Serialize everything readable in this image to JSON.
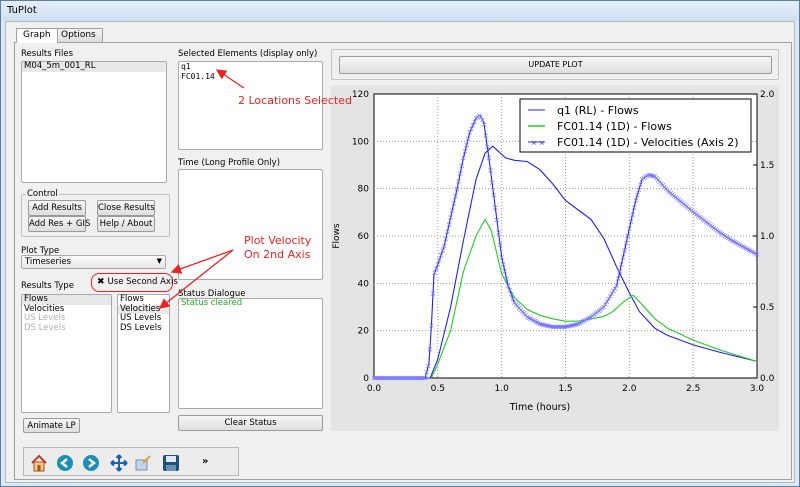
{
  "window": {
    "title": "TuPlot"
  },
  "tabs": [
    {
      "label": "Graph",
      "active": true
    },
    {
      "label": "Options",
      "active": false
    }
  ],
  "results_files": {
    "label": "Results Files",
    "items": [
      "M04_5m_001_RL"
    ]
  },
  "control": {
    "label": "Control",
    "buttons": [
      "Add Results",
      "Close Results",
      "Add Res + GIS",
      "Help / About"
    ]
  },
  "plot_type": {
    "label": "Plot Type",
    "value": "Timeseries"
  },
  "results_type": {
    "label": "Results Type",
    "list1": [
      {
        "label": "Flows",
        "state": "selected"
      },
      {
        "label": "Velocities",
        "state": "normal"
      },
      {
        "label": "US Levels",
        "state": "disabled"
      },
      {
        "label": "DS Levels",
        "state": "disabled"
      }
    ],
    "list2": [
      {
        "label": "Flows",
        "state": "normal"
      },
      {
        "label": "Velocities",
        "state": "selected"
      },
      {
        "label": "US Levels",
        "state": "normal"
      },
      {
        "label": "DS Levels",
        "state": "normal"
      }
    ]
  },
  "second_axis": {
    "label": "Use Second Axis",
    "checked": true
  },
  "animate_button": "Animate LP",
  "selected_elements": {
    "label": "Selected Elements (display only)",
    "items": [
      "q1",
      "FC01.14"
    ]
  },
  "time_box": {
    "label": "Time (Long Profile Only)"
  },
  "status": {
    "label": "Status Dialogue",
    "text": "Status cleared",
    "color": "#22aa22"
  },
  "clear_status": "Clear Status",
  "update_plot": "UPDATE PLOT",
  "toolbar": {
    "icons": [
      "home",
      "back",
      "forward",
      "pan",
      "zoom-rect",
      "save"
    ],
    "more": "»"
  },
  "annotations": {
    "locations": "2 Locations Selected",
    "velocity": [
      "Plot Velocity",
      "On 2nd Axis"
    ],
    "color": "#ee2222"
  },
  "chart_data": {
    "type": "line",
    "xlabel": "Time (hours)",
    "ylabel": "Flows",
    "y2label": "",
    "xlim": [
      0,
      3
    ],
    "ylim": [
      0,
      120
    ],
    "y2lim": [
      0,
      2
    ],
    "xticks": [
      "0.0",
      "0.5",
      "1.0",
      "1.5",
      "2.0",
      "2.5",
      "3.0"
    ],
    "yticks": [
      "0",
      "20",
      "40",
      "60",
      "80",
      "100",
      "120"
    ],
    "y2ticks": [
      "0.0",
      "0.5",
      "1.0",
      "1.5",
      "2.0"
    ],
    "grid": true,
    "legend_position": "top-right",
    "series": [
      {
        "name": "q1 (RL) - Flows",
        "color": "#2222ee",
        "axis": 1,
        "marker": "none",
        "x": [
          0,
          0.44,
          0.5,
          0.6,
          0.7,
          0.8,
          0.87,
          0.93,
          0.97,
          1.03,
          1.1,
          1.2,
          1.3,
          1.4,
          1.5,
          1.6,
          1.7,
          1.8,
          1.9,
          2.0,
          2.08,
          2.2,
          2.3,
          2.5,
          2.7,
          3.0
        ],
        "y": [
          0,
          0,
          8,
          30,
          58,
          84,
          95,
          98,
          96,
          93,
          92,
          91.5,
          88,
          82,
          75,
          71,
          67,
          59,
          47,
          36,
          28,
          21,
          18,
          14,
          11,
          7
        ]
      },
      {
        "name": "FC01.14 (1D) - Flows",
        "color": "#22cc22",
        "axis": 1,
        "marker": "none",
        "x": [
          0.45,
          0.5,
          0.6,
          0.7,
          0.8,
          0.87,
          0.92,
          1.0,
          1.1,
          1.2,
          1.3,
          1.4,
          1.5,
          1.6,
          1.7,
          1.8,
          1.87,
          1.95,
          2.03,
          2.1,
          2.2,
          2.3,
          2.5,
          2.7,
          3.0
        ],
        "y": [
          0,
          6,
          20,
          45,
          60,
          67,
          62,
          44,
          34,
          29,
          26.5,
          25,
          24,
          24,
          25,
          26,
          28,
          32,
          35,
          31,
          25,
          21,
          16,
          12,
          7
        ]
      },
      {
        "name": "FC01.14 (1D) - Velocities (Axis 2)",
        "color": "#2222ee",
        "axis": 2,
        "marker": "x",
        "x": [
          0,
          0.4,
          0.43,
          0.45,
          0.47,
          0.5,
          0.55,
          0.6,
          0.65,
          0.7,
          0.75,
          0.8,
          0.83,
          0.86,
          0.9,
          0.95,
          1.0,
          1.05,
          1.1,
          1.2,
          1.3,
          1.4,
          1.5,
          1.6,
          1.7,
          1.8,
          1.9,
          1.95,
          2.0,
          2.05,
          2.1,
          2.15,
          2.2,
          2.3,
          2.5,
          2.7,
          2.8,
          3.0
        ],
        "y": [
          0,
          0,
          0.1,
          0.37,
          0.73,
          0.8,
          0.93,
          1.13,
          1.33,
          1.55,
          1.73,
          1.83,
          1.85,
          1.8,
          1.55,
          1.2,
          0.85,
          0.65,
          0.53,
          0.43,
          0.38,
          0.36,
          0.36,
          0.38,
          0.43,
          0.5,
          0.65,
          0.85,
          1.05,
          1.25,
          1.4,
          1.43,
          1.42,
          1.32,
          1.17,
          1.03,
          0.97,
          0.87
        ]
      }
    ]
  }
}
